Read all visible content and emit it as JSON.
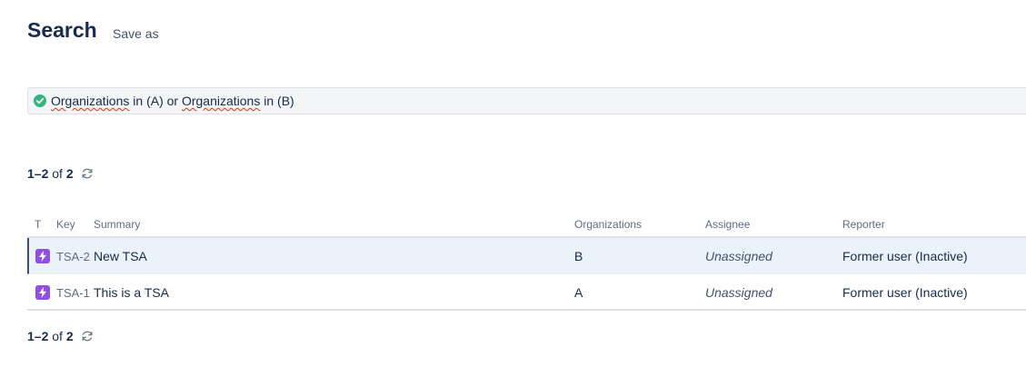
{
  "header": {
    "title": "Search",
    "save_as": "Save as"
  },
  "query": {
    "status_icon": "check-circle-icon",
    "status_color": "#36b37e",
    "part1": "Organizations",
    "part2": " in (A) or ",
    "part3": "Organizations",
    "part4": " in (B)"
  },
  "pagination": {
    "range": "1–2",
    "of_label": "of",
    "total": "2",
    "refresh_icon": "refresh-icon"
  },
  "table": {
    "columns": {
      "type": "T",
      "key": "Key",
      "summary": "Summary",
      "organizations": "Organizations",
      "assignee": "Assignee",
      "reporter": "Reporter"
    },
    "rows": [
      {
        "type_icon": "lightning-icon",
        "key": "TSA-2",
        "summary": "New TSA",
        "organizations": "B",
        "assignee": "Unassigned",
        "reporter": "Former user (Inactive)"
      },
      {
        "type_icon": "lightning-icon",
        "key": "TSA-1",
        "summary": "This is a TSA",
        "organizations": "A",
        "assignee": "Unassigned",
        "reporter": "Former user (Inactive)"
      }
    ]
  },
  "colors": {
    "type_icon_bg": "#904ee2",
    "selected_row_bg": "#ebf2fa",
    "text": "#172b4d"
  }
}
